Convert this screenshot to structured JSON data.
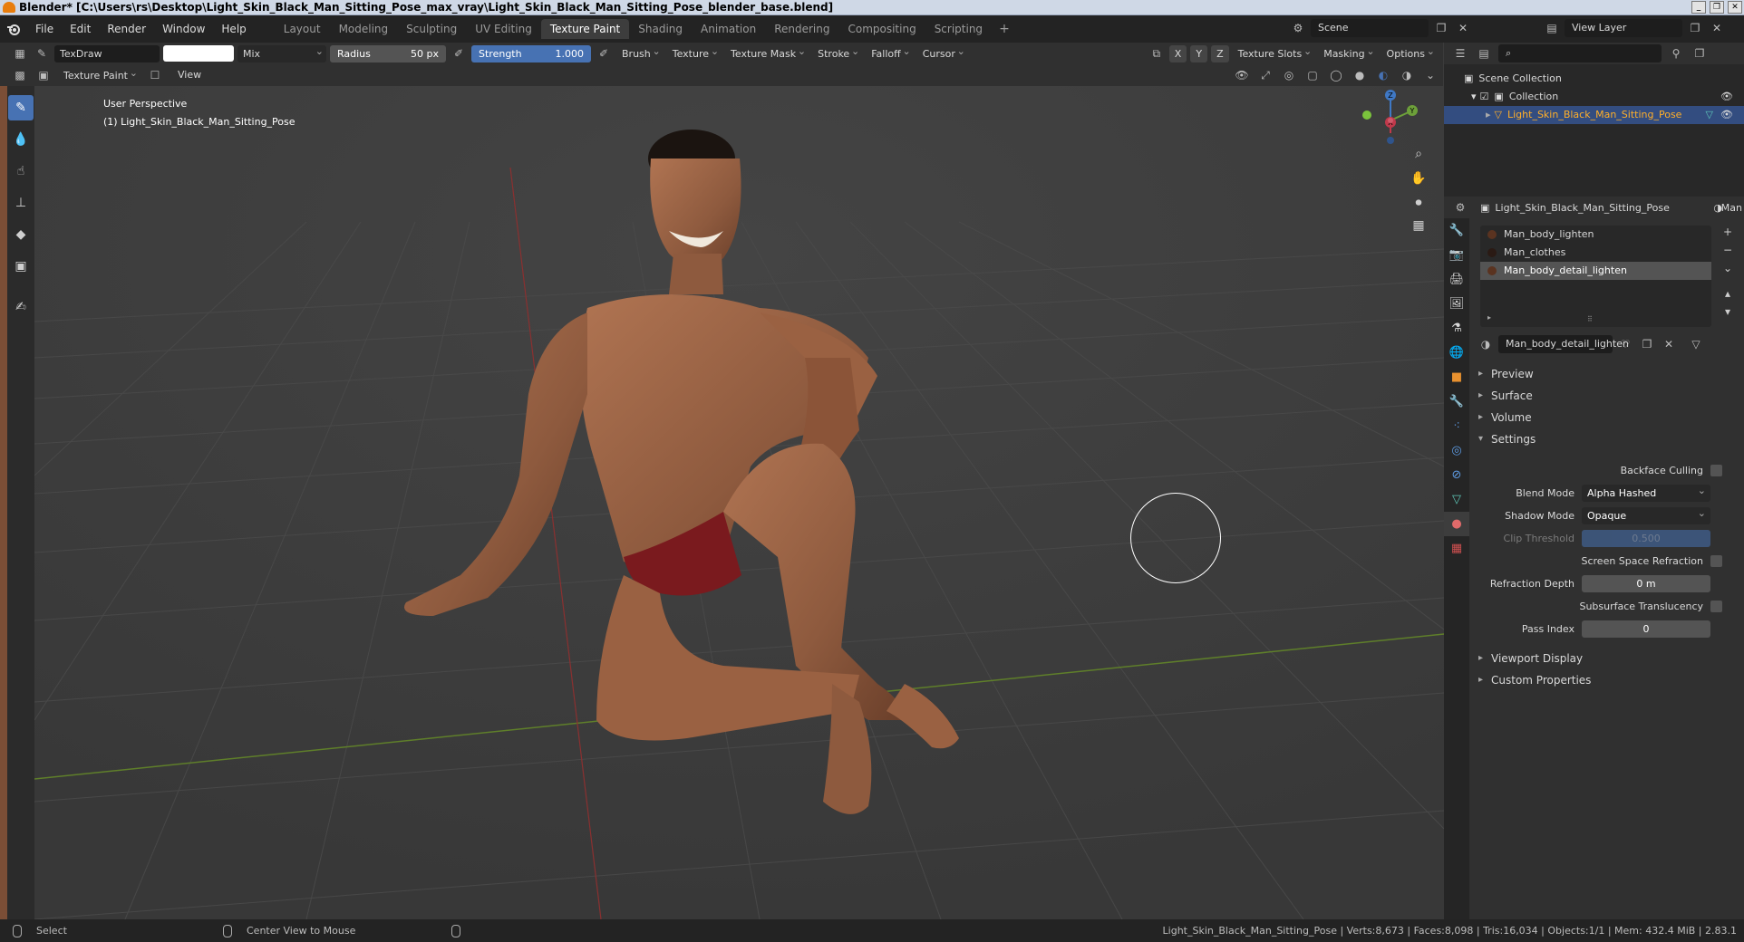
{
  "window": {
    "title": "Blender* [C:\\Users\\rs\\Desktop\\Light_Skin_Black_Man_Sitting_Pose_max_vray\\Light_Skin_Black_Man_Sitting_Pose_blender_base.blend]",
    "controls": [
      "_",
      "❐",
      "✕"
    ]
  },
  "menu": {
    "items": [
      "File",
      "Edit",
      "Render",
      "Window",
      "Help"
    ],
    "tabs": [
      "Layout",
      "Modeling",
      "Sculpting",
      "UV Editing",
      "Texture Paint",
      "Shading",
      "Animation",
      "Rendering",
      "Compositing",
      "Scripting"
    ],
    "active_tab": "Texture Paint",
    "add_tab": "+",
    "scene": "Scene",
    "view_layer": "View Layer"
  },
  "tool_header": {
    "brush_name": "TexDraw",
    "blend_mode": "Mix",
    "radius_label": "Radius",
    "radius_value": "50 px",
    "strength_label": "Strength",
    "strength_value": "1.000",
    "dropdowns": [
      "Brush",
      "Texture",
      "Texture Mask",
      "Stroke",
      "Falloff",
      "Cursor"
    ],
    "axes": [
      "X",
      "Y",
      "Z"
    ],
    "right_dropdowns": [
      "Texture Slots",
      "Masking",
      "Options"
    ]
  },
  "mode_header": {
    "mode": "Texture Paint",
    "view": "View"
  },
  "viewport": {
    "perspective": "User Perspective",
    "object_info": "(1) Light_Skin_Black_Man_Sitting_Pose",
    "gizmo_axes": [
      "X",
      "Y",
      "Z"
    ]
  },
  "outliner": {
    "scene_collection": "Scene Collection",
    "collection": "Collection",
    "object": "Light_Skin_Black_Man_Sitting_Pose"
  },
  "properties": {
    "object_name": "Light_Skin_Black_Man_Sitting_Pose",
    "tab_truncated": "Man",
    "materials": [
      "Man_body_lighten",
      "Man_clothes",
      "Man_body_detail_lighten"
    ],
    "selected_material": "Man_body_detail_lighten",
    "panels": {
      "preview": "Preview",
      "surface": "Surface",
      "volume": "Volume",
      "settings": "Settings",
      "viewport_display": "Viewport Display",
      "custom_properties": "Custom Properties"
    },
    "settings": {
      "backface_culling": "Backface Culling",
      "blend_mode_label": "Blend Mode",
      "blend_mode_value": "Alpha Hashed",
      "shadow_mode_label": "Shadow Mode",
      "shadow_mode_value": "Opaque",
      "clip_threshold_label": "Clip Threshold",
      "clip_threshold_value": "0.500",
      "ssr_label": "Screen Space Refraction",
      "refraction_depth_label": "Refraction Depth",
      "refraction_depth_value": "0 m",
      "subsurface_label": "Subsurface Translucency",
      "pass_index_label": "Pass Index",
      "pass_index_value": "0"
    }
  },
  "status": {
    "select": "Select",
    "center_view": "Center View to Mouse",
    "stats": "Light_Skin_Black_Man_Sitting_Pose | Verts:8,673 | Faces:8,098 | Tris:16,034 | Objects:1/1 | Mem: 432.4 MiB | 2.83.1"
  },
  "colors": {
    "accent_blue": "#4772b3",
    "active_object": "#ffaf29",
    "skin": "#9a6142",
    "underwear": "#7a1a1e"
  }
}
